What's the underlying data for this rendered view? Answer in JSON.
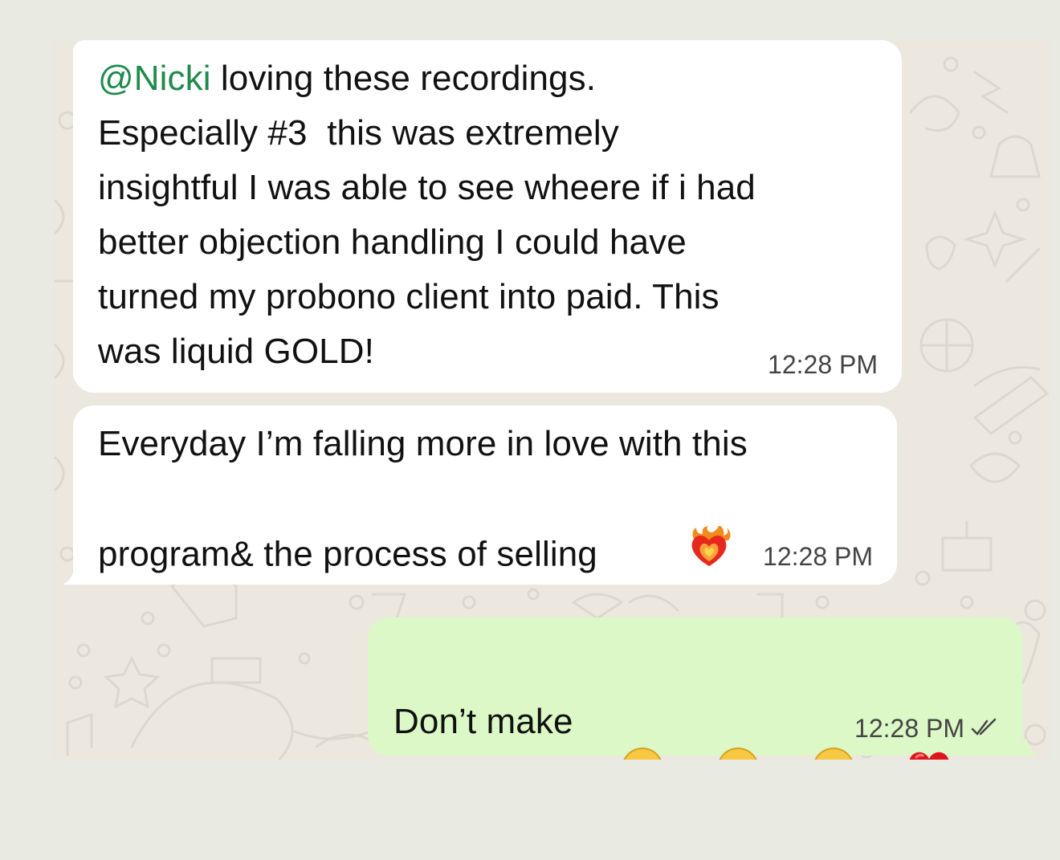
{
  "messages": [
    {
      "direction": "incoming",
      "mention": "@Nicki",
      "text_after_mention": " loving these recordings.",
      "lines": [
        "Especially #3  this was extremely",
        "insightful I was able to see wheere if i had",
        "better objection handling I could have",
        "turned my probono client into paid. This",
        "was liquid GOLD!"
      ],
      "time": "12:28 PM"
    },
    {
      "direction": "incoming",
      "lines": [
        "Everyday I’m falling more in love with this",
        "program& the process of selling"
      ],
      "emoji": "heart-on-fire",
      "time": "12:28 PM"
    },
    {
      "direction": "outgoing",
      "text": "Don’t make me cry",
      "emojis": [
        "pleading-face",
        "pleading-face",
        "pleading-face",
        "red-heart"
      ],
      "time": "12:28 PM",
      "status": "read-double-check"
    }
  ],
  "colors": {
    "incoming_bubble": "#ffffff",
    "outgoing_bubble": "#dcf8c6",
    "mention": "#1f8a4c",
    "wallpaper": "#ece8e0",
    "page_background": "#e9ebe2",
    "read_ticks": "#444444"
  }
}
